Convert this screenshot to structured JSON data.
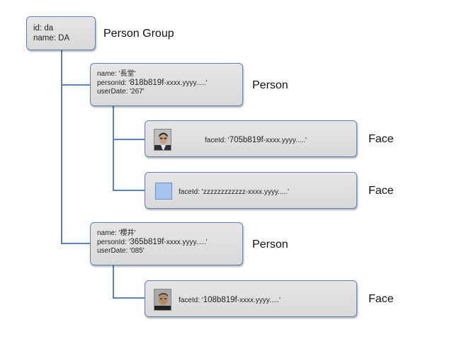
{
  "group": {
    "id_line": "id: da",
    "name_line": "name: DA",
    "label": "Person Group"
  },
  "persons": [
    {
      "name_line": "name: '長堂'",
      "person_id_prefix": "personId: '",
      "person_id_main": "818b819f",
      "person_id_suffix": "-xxxx.yyyy.....'",
      "user_date_line": "userDate: '267'",
      "label": "Person",
      "faces": [
        {
          "prefix": "faceId: '",
          "main": "705b819f",
          "suffix": "-xxxx.yyyy.....'",
          "label": "Face",
          "thumbnail": "face-photo"
        },
        {
          "prefix": "faceId: 'zzzzzzzzzzzz",
          "main": "",
          "suffix": "-xxxx.yyyy.....'",
          "label": "Face",
          "thumbnail": "blue-square"
        }
      ]
    },
    {
      "name_line": "name: '櫻井'",
      "person_id_prefix": "personId: '",
      "person_id_main": "365b819f",
      "person_id_suffix": "-xxxx.yyyy.....'",
      "user_date_line": "userDate: '085'",
      "label": "Person",
      "faces": [
        {
          "prefix": "faceId: '",
          "main": "108b819f",
          "suffix": "-xxxx.yyyy.....'",
          "label": "Face",
          "thumbnail": "face-photo"
        }
      ]
    }
  ],
  "colors": {
    "box_border": "#5b83b8",
    "box_fill": "#e0e0e0",
    "connector": "#5b83b8",
    "placeholder": "#a7c4ee"
  }
}
